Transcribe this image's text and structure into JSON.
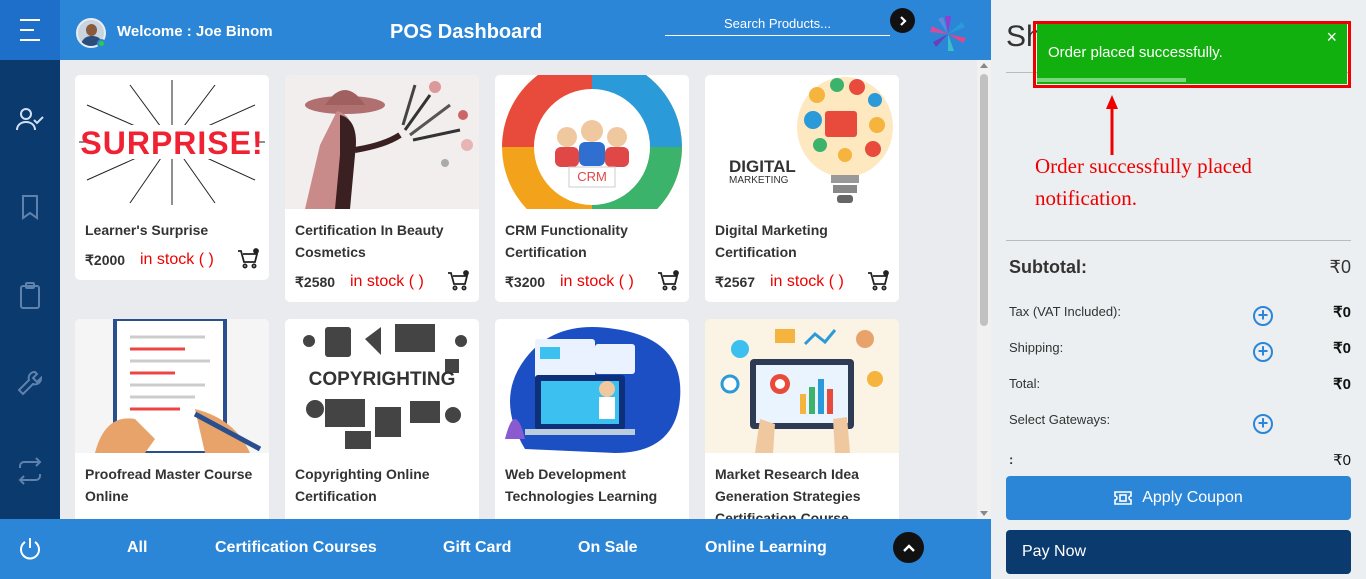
{
  "header": {
    "welcome": "Welcome : Joe Binom",
    "title": "POS Dashboard",
    "search_placeholder": "Search Products..."
  },
  "sidebar": {
    "icons": [
      "menu-icon",
      "user-check-icon",
      "bookmark-icon",
      "clipboard-icon",
      "wrench-icon",
      "repeat-icon",
      "power-icon"
    ]
  },
  "products": [
    {
      "name": "Learner's Surprise",
      "price": "₹2000",
      "stock": "in stock ( )",
      "image_text": "SURPRISE!"
    },
    {
      "name": "Certification In Beauty Cosmetics",
      "price": "₹2580",
      "stock": "in stock ( )",
      "image_text": ""
    },
    {
      "name": "CRM Functionality Certification",
      "price": "₹3200",
      "stock": "in stock ( )",
      "image_text": "CRM"
    },
    {
      "name": "Digital Marketing Certification",
      "price": "₹2567",
      "stock": "in stock ( )",
      "image_text": "DIGITAL",
      "image_text2": "MARKETING"
    },
    {
      "name": "Proofread Master Course Online",
      "image_text": ""
    },
    {
      "name": "Copyrighting Online Certification",
      "image_text": "COPYRIGHTING"
    },
    {
      "name": "Web Development Technologies Learning",
      "image_text": ""
    },
    {
      "name": "Market Research Idea Generation Strategies Certification Course",
      "image_text": ""
    }
  ],
  "categories": [
    "All",
    "Certification Courses",
    "Gift Card",
    "On Sale",
    "Online Learning"
  ],
  "cart": {
    "heading": "Sh",
    "subtotal_label": "Subtotal:",
    "subtotal_value": "₹0",
    "tax_label": "Tax (VAT Included):",
    "tax_value": "₹0",
    "shipping_label": "Shipping:",
    "shipping_value": "₹0",
    "total_label": "Total:",
    "total_value": "₹0",
    "gateways_label": "Select Gateways:",
    "extra_label": ":",
    "extra_value": "₹0",
    "coupon_label": "Apply Coupon",
    "pay_label": "Pay Now"
  },
  "toast": {
    "message": "Order placed successfully.",
    "close": "×",
    "progress": 0.48
  },
  "annotation": "Order successfully placed notification.",
  "colors": {
    "primary": "#2b86d8",
    "dark_navy": "#0b3a6e",
    "success": "#11b00e",
    "stock_red": "#ee0000",
    "annotation_red": "#e00000"
  }
}
